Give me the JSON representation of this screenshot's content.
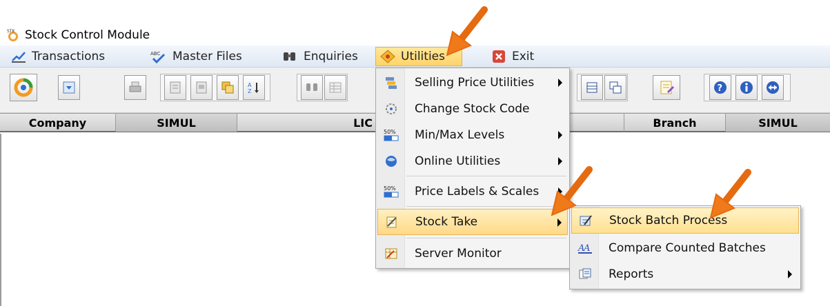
{
  "window": {
    "title": "Stock Control Module"
  },
  "menubar": {
    "items": [
      {
        "label": "Transactions",
        "icon": "chart-icon"
      },
      {
        "label": "Master Files",
        "icon": "abc-spellcheck-icon"
      },
      {
        "label": "Enquiries",
        "icon": "binoculars-icon"
      },
      {
        "label": "Utilities",
        "icon": "utilities-icon",
        "active": true
      },
      {
        "label": "Exit",
        "icon": "close-icon"
      }
    ]
  },
  "infobar": {
    "company_label": "Company",
    "company_value": "SIMUL",
    "middle_value": "LIC",
    "branch_label": "Branch",
    "branch_value": "SIMUL"
  },
  "utilities_menu": {
    "items": [
      {
        "label": "Selling Price Utilities",
        "submenu": true
      },
      {
        "label": "Change Stock Code",
        "submenu": false
      },
      {
        "label": "Min/Max Levels",
        "submenu": true
      },
      {
        "label": "Online Utilities",
        "submenu": true
      },
      {
        "label": "Price Labels & Scales",
        "submenu": true
      },
      {
        "label": "Stock Take",
        "submenu": true,
        "highlighted": true
      },
      {
        "label": "Server Monitor",
        "submenu": false
      }
    ]
  },
  "stock_take_submenu": {
    "items": [
      {
        "label": "Stock Batch Process",
        "highlighted": true
      },
      {
        "label": "Compare Counted Batches"
      },
      {
        "label": "Reports",
        "submenu": true
      }
    ]
  },
  "colors": {
    "highlight": "#ffd987",
    "arrow": "#f07a1a",
    "menubar": "#dfe8f3"
  }
}
